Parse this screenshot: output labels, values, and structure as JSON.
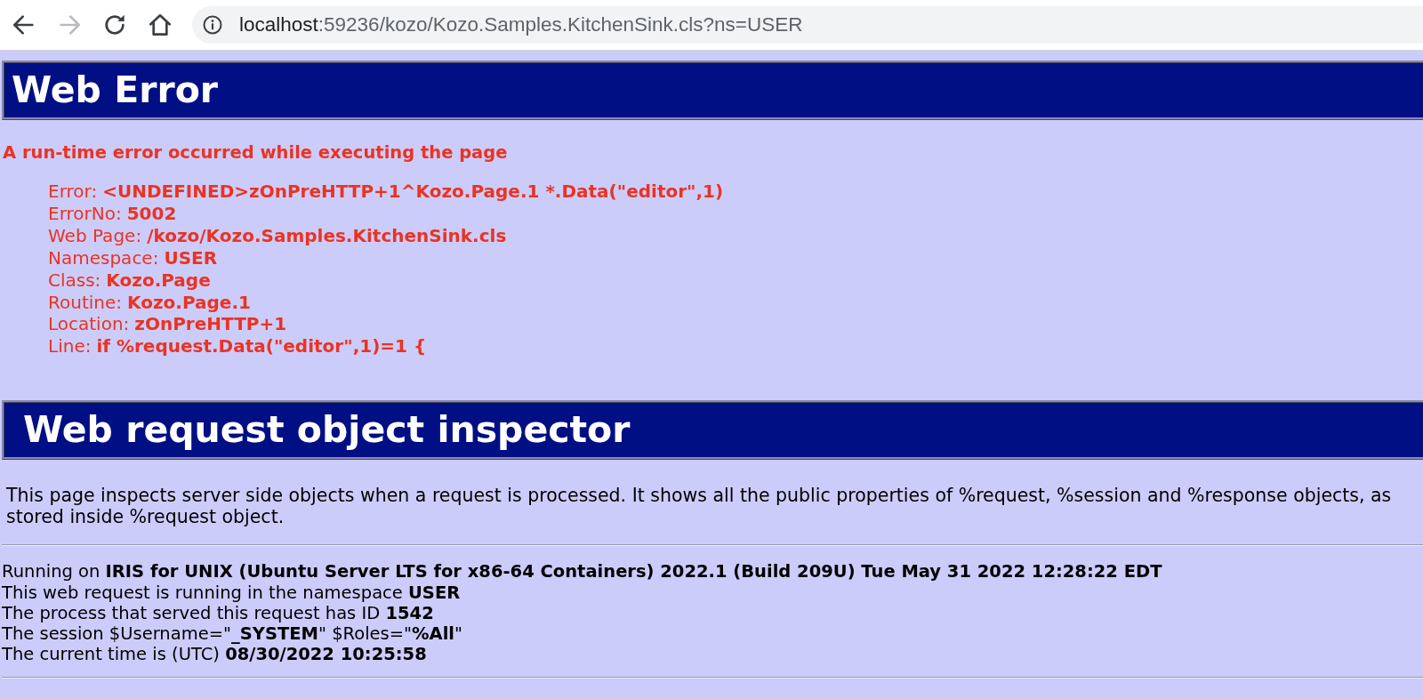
{
  "browser": {
    "nav_buttons": [
      {
        "kind": "back",
        "disabled": false
      },
      {
        "kind": "forward",
        "disabled": true
      },
      {
        "kind": "reload",
        "disabled": false
      },
      {
        "kind": "home",
        "disabled": false
      }
    ],
    "address": {
      "host": "localhost",
      "rest": ":59236/kozo/Kozo.Samples.KitchenSink.cls?ns=USER"
    }
  },
  "error_section": {
    "title": "Web Error",
    "message": "A run-time error occurred while executing the page",
    "details": [
      {
        "label": "Error:",
        "value": "<UNDEFINED>zOnPreHTTP+1^Kozo.Page.1 *.Data(\"editor\",1)"
      },
      {
        "label": "ErrorNo:",
        "value": "5002"
      },
      {
        "label": "Web Page:",
        "value": "/kozo/Kozo.Samples.KitchenSink.cls"
      },
      {
        "label": "Namespace:",
        "value": "USER"
      },
      {
        "label": "Class:",
        "value": "Kozo.Page"
      },
      {
        "label": "Routine:",
        "value": "Kozo.Page.1"
      },
      {
        "label": "Location:",
        "value": "zOnPreHTTP+1"
      },
      {
        "label": "Line:",
        "value": "if %request.Data(\"editor\",1)=1 {"
      }
    ]
  },
  "inspector": {
    "title": "Web request object inspector",
    "intro_lines": [
      "This page inspects server side objects when a request is processed. It shows all the public properties of %request, %session and %response objects, as",
      "stored inside %request object."
    ],
    "info_lines": [
      "Running on **IRIS for UNIX (Ubuntu Server LTS for x86-64 Containers) 2022.1 (Build 209U) Tue May 31 2022 12:28:22 EDT**",
      "This web request is running in the namespace **USER**",
      "The process that served this request has ID **1542**",
      "The session $Username=\"**_SYSTEM**\" $Roles=\"**%All**\"",
      "The current time is (UTC) **08/30/2022 10:25:58**"
    ]
  }
}
